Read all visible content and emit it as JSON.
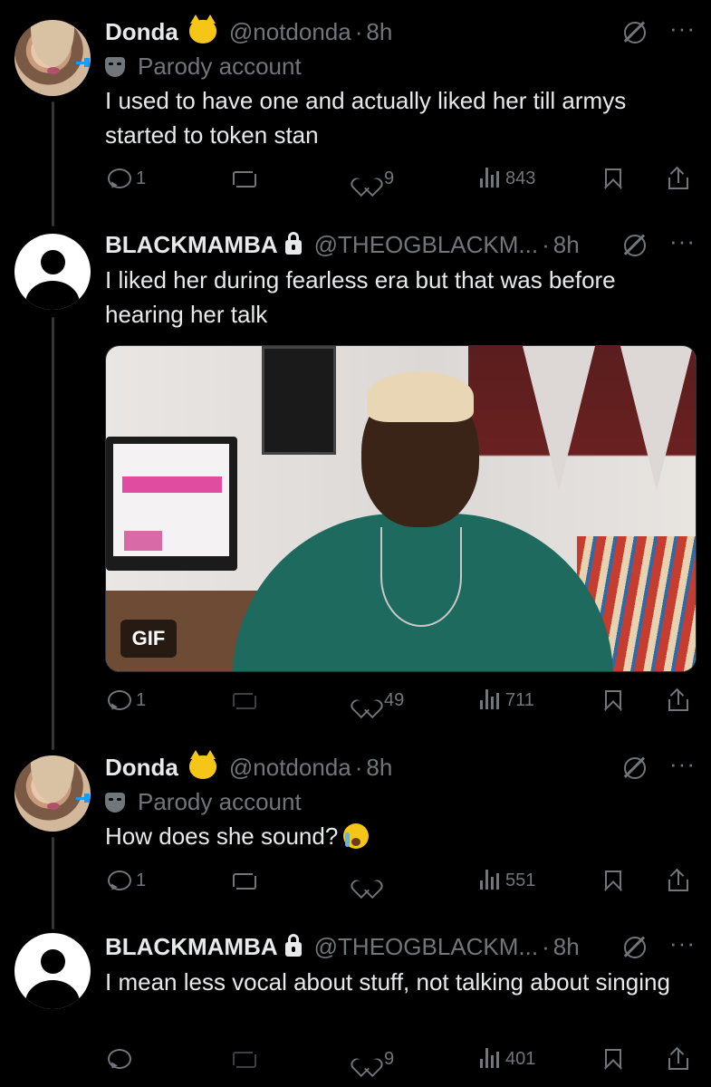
{
  "tweets": [
    {
      "name": "Donda",
      "handle": "@notdonda",
      "separator": "·",
      "time": "8h",
      "parody_label": "Parody account",
      "text": "I used to have one and actually liked her till armys started to token stan",
      "emoji": "smirking-cat",
      "stats": {
        "replies": "1",
        "reposts": "",
        "likes": "9",
        "views": "843"
      }
    },
    {
      "name": "BLACKMAMBA",
      "handle": "@THEOGBLACKM...",
      "separator": "·",
      "time": "8h",
      "protected": true,
      "text": "I liked her during fearless era but that was before hearing her talk",
      "media": {
        "type": "gif",
        "badge": "GIF"
      },
      "stats": {
        "replies": "1",
        "reposts": "",
        "likes": "49",
        "views": "711"
      }
    },
    {
      "name": "Donda",
      "handle": "@notdonda",
      "separator": "·",
      "time": "8h",
      "parody_label": "Parody account",
      "text": "How does she sound?",
      "text_emoji": "loudly-crying-face",
      "emoji": "smirking-cat",
      "stats": {
        "replies": "1",
        "reposts": "",
        "likes": "",
        "views": "551"
      }
    },
    {
      "name": "BLACKMAMBA",
      "handle": "@THEOGBLACKM...",
      "separator": "·",
      "time": "8h",
      "protected": true,
      "text": "I mean less vocal about stuff, not talking about singing",
      "stats": {
        "replies": "",
        "reposts": "",
        "likes": "9",
        "views": "401"
      }
    }
  ],
  "icons": {
    "reply": "reply-icon",
    "repost": "repost-icon",
    "like": "like-icon",
    "views": "views-icon",
    "bookmark": "bookmark-icon",
    "share": "share-icon",
    "grok": "grok-icon",
    "more": "more-icon",
    "more_glyph": "···"
  },
  "colors": {
    "background": "#000000",
    "text_primary": "#e7e9ea",
    "text_secondary": "#71767b",
    "accent": "#1d9bf0"
  }
}
